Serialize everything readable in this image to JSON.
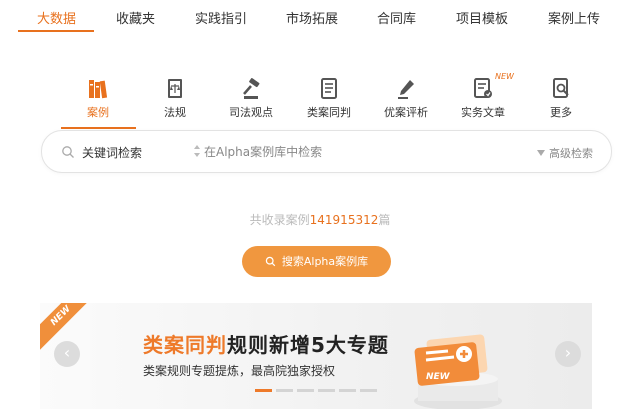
{
  "nav": {
    "tabs": [
      {
        "label": "大数据",
        "active": true
      },
      {
        "label": "收藏夹",
        "active": false
      },
      {
        "label": "实践指引",
        "active": false
      },
      {
        "label": "市场拓展",
        "active": false
      },
      {
        "label": "合同库",
        "active": false
      },
      {
        "label": "项目模板",
        "active": false
      },
      {
        "label": "案例上传",
        "active": false
      }
    ]
  },
  "categories": {
    "items": [
      {
        "label": "案例",
        "icon": "books-icon",
        "active": true
      },
      {
        "label": "法规",
        "icon": "law-book-icon",
        "active": false
      },
      {
        "label": "司法观点",
        "icon": "gavel-icon",
        "active": false
      },
      {
        "label": "类案同判",
        "icon": "document-icon",
        "active": false
      },
      {
        "label": "优案评析",
        "icon": "pen-icon",
        "active": false
      },
      {
        "label": "实务文章",
        "icon": "article-icon",
        "active": false
      },
      {
        "label": "更多",
        "icon": "search-document-icon",
        "active": false
      }
    ],
    "new_badge": "NEW"
  },
  "search": {
    "mode_label": "关键词检索",
    "placeholder": "在Alpha案例库中检索",
    "advanced_label": "高级检索"
  },
  "count": {
    "prefix": "共收录案例",
    "number": "141915312",
    "suffix": "篇"
  },
  "search_button": {
    "label": "搜索Alpha案例库"
  },
  "banner": {
    "ribbon": "NEW",
    "title_highlight": "类案同判",
    "title_rest": "规则新增5大专题",
    "subtitle": "类案规则专题提炼，最高院独家授权",
    "badge_text": "NEW",
    "slide_count": 6,
    "active_slide": 0
  },
  "colors": {
    "accent": "#e8711e",
    "button": "#f0973f",
    "banner_highlight": "#ee7a2a"
  }
}
